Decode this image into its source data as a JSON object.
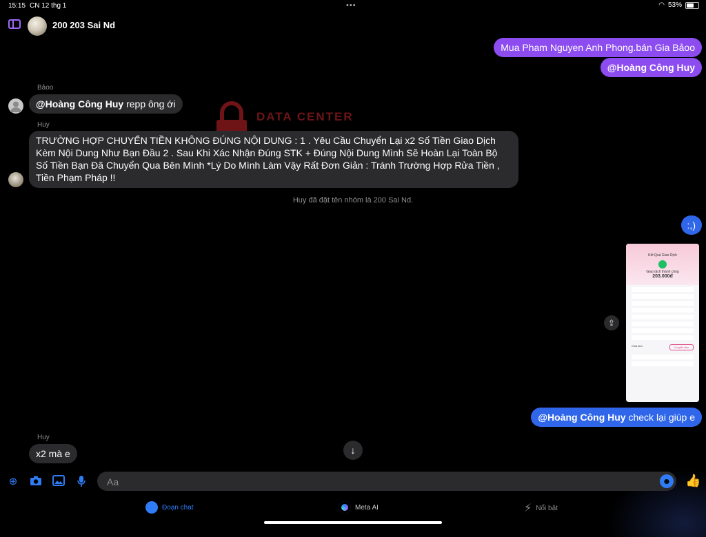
{
  "status": {
    "time": "15:15",
    "date": "CN 12 thg 1",
    "battery_text": "53%",
    "battery_level": 0.53
  },
  "header": {
    "title": "200 203 Sai Nd"
  },
  "watermark": {
    "text": "DATA CENTER"
  },
  "messages": {
    "m1": {
      "text": "Mua Pham Nguyen Anh Phong.bán Gia Bảoo"
    },
    "m2": {
      "mention": "@Hoàng Công Huy"
    },
    "m3": {
      "sender": "Bảoo",
      "mention": "@Hoàng Công Huy",
      "text": " repp ông ới"
    },
    "m4": {
      "sender": "Huy",
      "text": "TRƯỜNG HỢP CHUYỂN TIỀN KHÔNG ĐÚNG NỘI DUNG :  1 . Yêu Cầu Chuyển Lại x2 Số Tiền Giao Dịch Kèm Nội Dung Như Bạn Đầu  2 . Sau Khi Xác Nhận Đúng STK + Đúng Nội Dung Mình Sẽ Hoàn Lại Toàn Bộ Số Tiền Bạn Đã Chuyển Qua Bên Mình  *Lý Do Mình Làm Vậy Rất Đơn Giản : Tránh Trường Hợp Rửa Tiền , Tiền Phạm Pháp !!"
    },
    "system": "Huy đã đặt tên nhóm là 200 Sai Nd.",
    "m5": {
      "text": ":,)"
    },
    "m6": {
      "mention": "@Hoàng Công Huy",
      "text": " check lại giúp e"
    },
    "m7": {
      "sender": "Huy",
      "text": "x2 mà e"
    }
  },
  "receipt": {
    "title": "Kết Quả Giao Dịch",
    "status": "Giao dịch thành công",
    "amount": "203.000đ",
    "share": "Chia tiền",
    "transfer": "Chuyển tiền"
  },
  "composer": {
    "placeholder": "Aa"
  },
  "tabs": {
    "chat": "Đoạn chat",
    "meta_ai": "Meta AI",
    "highlights": "Nổi bật"
  },
  "colors": {
    "accent_purple": "#8c4cf0",
    "accent_blue": "#2f66ea",
    "tab_active": "#2f7cf6"
  }
}
